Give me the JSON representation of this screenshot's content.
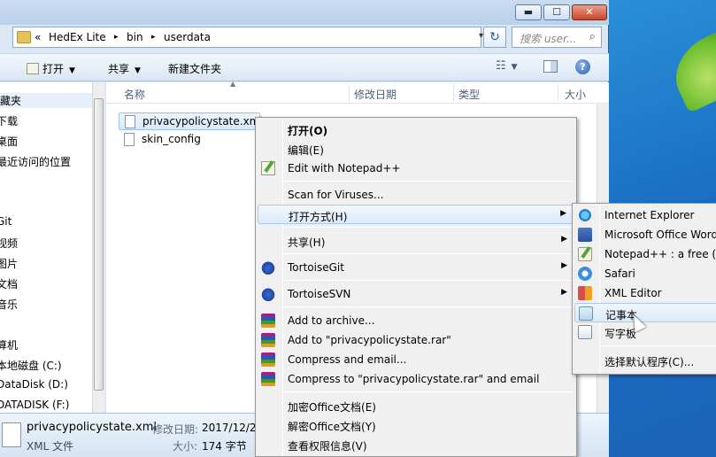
{
  "window": {
    "controls": {
      "minimize": "▬",
      "maximize": "☐",
      "close": "✕"
    }
  },
  "address": {
    "chevron": "«",
    "crumbs": [
      "HedEx Lite",
      "bin",
      "userdata"
    ],
    "separator": "▸",
    "dropdown": "▾",
    "refresh": "↻",
    "search_placeholder": "搜索 user...",
    "search_icon": "⌕"
  },
  "toolbar": {
    "open_label": "打开",
    "share_label": "共享",
    "newfolder_label": "新建文件夹",
    "dd": "▼",
    "views_icon": "☷",
    "help": "?"
  },
  "nav": {
    "items": [
      "藏夹",
      "下载",
      "桌面",
      "最近访问的位置",
      "Git",
      "视频",
      "图片",
      "文档",
      "音乐",
      "算机",
      "本地磁盘 (C:)",
      "DataDisk (D:)",
      "DATADISK (F:)"
    ],
    "selected_index": 0
  },
  "columns": {
    "name": "名称",
    "modified": "修改日期",
    "type": "类型",
    "size": "大小",
    "sort_arrow": "▲"
  },
  "files": [
    {
      "name": "privacypolicystate.xml",
      "selected": true
    },
    {
      "name": "skin_config",
      "selected": false
    }
  ],
  "details": {
    "filename": "privacypolicystate.xml",
    "filetype": "XML 文件",
    "modified_label": "修改日期:",
    "modified_value": "2017/12/2",
    "size_label": "大小:",
    "size_value": "174 字节"
  },
  "context_menu": {
    "items": [
      {
        "label": "打开(O)",
        "bold": true,
        "icon": ""
      },
      {
        "label": "编辑(E)",
        "icon": ""
      },
      {
        "label": "Edit with Notepad++",
        "icon": "notepadpp-icon"
      },
      {
        "separator": true
      },
      {
        "label": "Scan for Viruses...",
        "icon": ""
      },
      {
        "label": "打开方式(H)",
        "submenu": true,
        "highlighted": true,
        "icon": ""
      },
      {
        "separator": true
      },
      {
        "label": "共享(H)",
        "submenu": true,
        "icon": ""
      },
      {
        "separator": true
      },
      {
        "label": "TortoiseGit",
        "submenu": true,
        "icon": "tortoise-icon"
      },
      {
        "separator": true
      },
      {
        "label": "TortoiseSVN",
        "submenu": true,
        "icon": "tortoise-icon"
      },
      {
        "separator": true
      },
      {
        "label": "Add to archive...",
        "icon": "winrar-icon"
      },
      {
        "label": "Add to \"privacypolicystate.rar\"",
        "icon": "winrar-icon"
      },
      {
        "label": "Compress and email...",
        "icon": "winrar-icon"
      },
      {
        "label": "Compress to \"privacypolicystate.rar\" and email",
        "icon": "winrar-icon"
      },
      {
        "separator": true
      },
      {
        "label": "加密Office文档(E)",
        "icon": ""
      },
      {
        "label": "解密Office文档(Y)",
        "icon": ""
      },
      {
        "label": "查看权限信息(V)",
        "icon": ""
      }
    ],
    "arrow": "▶"
  },
  "open_with_menu": {
    "items": [
      {
        "label": "Internet Explorer",
        "icon": "ie-icon"
      },
      {
        "label": "Microsoft Office Word",
        "icon": "word-icon"
      },
      {
        "label": "Notepad++ : a free (G",
        "icon": "notepadpp-icon"
      },
      {
        "label": "Safari",
        "icon": "safari-icon"
      },
      {
        "label": "XML Editor",
        "icon": "xml-editor-icon"
      },
      {
        "label": "记事本",
        "icon": "notepad-icon",
        "highlighted": true
      },
      {
        "label": "写字板",
        "icon": "wordpad-icon"
      },
      {
        "separator": true
      },
      {
        "label": "选择默认程序(C)...",
        "icon": ""
      }
    ]
  }
}
